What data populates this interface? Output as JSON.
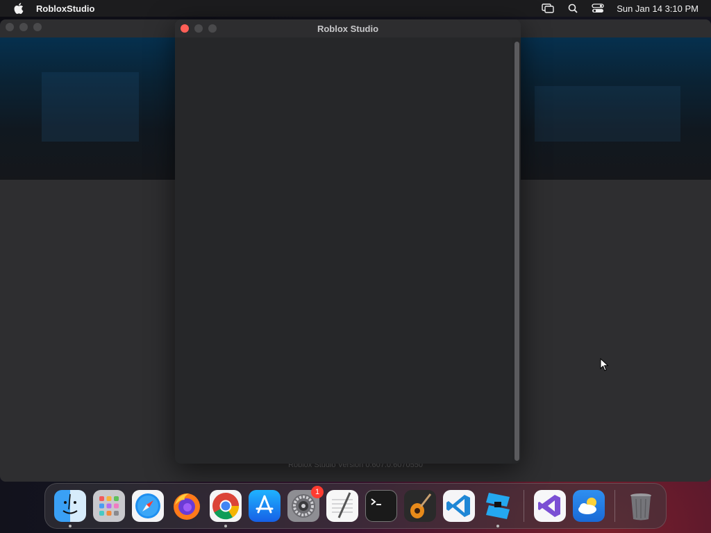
{
  "menubar": {
    "app_name": "RobloxStudio",
    "clock": "Sun Jan 14  3:10 PM",
    "icons": [
      "apple-icon",
      "screen-mirroring-icon",
      "spotlight-search-icon",
      "control-center-icon"
    ]
  },
  "background_window": {
    "version_text": "Roblox Studio Version 0.607.0.6070550"
  },
  "dialog": {
    "title": "Roblox Studio"
  },
  "dock": {
    "items": [
      {
        "name": "finder",
        "running": true
      },
      {
        "name": "launchpad",
        "running": false
      },
      {
        "name": "safari",
        "running": false
      },
      {
        "name": "firefox",
        "running": false
      },
      {
        "name": "chrome",
        "running": true
      },
      {
        "name": "app-store",
        "running": false
      },
      {
        "name": "system-settings",
        "running": false,
        "badge": "1"
      },
      {
        "name": "textedit",
        "running": false
      },
      {
        "name": "terminal",
        "running": false
      },
      {
        "name": "garageband",
        "running": false
      },
      {
        "name": "vscode",
        "running": false
      },
      {
        "name": "roblox-studio",
        "running": true
      },
      {
        "name": "visual-studio",
        "running": false
      },
      {
        "name": "weather",
        "running": false
      },
      {
        "name": "trash",
        "running": false
      }
    ]
  },
  "colors": {
    "close_red": "#ff5f57",
    "dialog_bg": "#252628",
    "menubar_bg": "#1c1c1e"
  }
}
